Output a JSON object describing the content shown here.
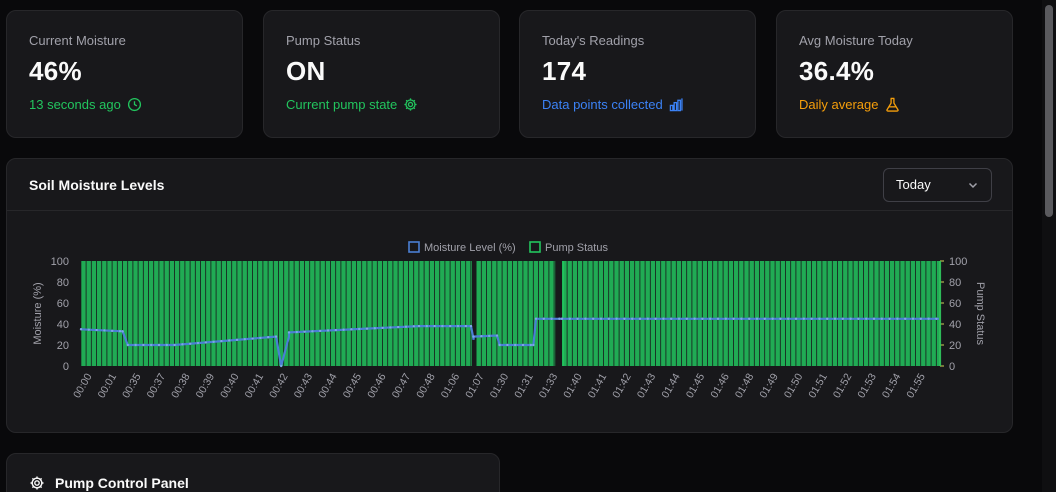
{
  "stats": [
    {
      "label": "Current Moisture",
      "value": "46%",
      "sub": "13 seconds ago",
      "color": "#22c55e",
      "icon": "clock-icon"
    },
    {
      "label": "Pump Status",
      "value": "ON",
      "sub": "Current pump state",
      "color": "#22c55e",
      "icon": "gear-icon"
    },
    {
      "label": "Today's Readings",
      "value": "174",
      "sub": "Data points collected",
      "color": "#3b82f6",
      "icon": "bar-chart-icon"
    },
    {
      "label": "Avg Moisture Today",
      "value": "36.4%",
      "sub": "Daily average",
      "color": "#f59e0b",
      "icon": "flask-icon"
    }
  ],
  "chart": {
    "title": "Soil Moisture Levels",
    "range_select": "Today"
  },
  "pump_panel": {
    "title": "Pump Control Panel"
  },
  "chart_data": {
    "type": "bar",
    "legend": [
      "Moisture Level (%)",
      "Pump Status"
    ],
    "legend_position": "top-center",
    "ylabel_left": "Moisture (%)",
    "ylabel_right": "Pump Status",
    "ylim": [
      0,
      100
    ],
    "yticks": [
      0,
      20,
      40,
      60,
      80,
      100
    ],
    "colors": {
      "moisture": "#4a7fd4",
      "pump": "#22c55e"
    },
    "x_tick_labels": [
      "00:00",
      "00:01",
      "00:35",
      "00:37",
      "00:38",
      "00:39",
      "00:40",
      "00:41",
      "00:42",
      "00:43",
      "00:44",
      "00:45",
      "00:46",
      "00:47",
      "00:48",
      "01:06",
      "01:07",
      "01:30",
      "01:31",
      "01:33",
      "01:40",
      "01:41",
      "01:42",
      "01:43",
      "01:44",
      "01:45",
      "01:46",
      "01:48",
      "01:49",
      "01:50",
      "01:51",
      "01:52",
      "01:53",
      "01:54",
      "01:55"
    ],
    "moisture_segments": [
      {
        "from": 0,
        "to": 16,
        "start": 35,
        "end": 33
      },
      {
        "from": 16,
        "to": 18,
        "start": 33,
        "end": 20
      },
      {
        "from": 18,
        "to": 36,
        "start": 20,
        "end": 20
      },
      {
        "from": 36,
        "to": 75,
        "start": 20,
        "end": 28
      },
      {
        "from": 75,
        "to": 77,
        "start": 28,
        "end": 0
      },
      {
        "from": 77,
        "to": 80,
        "start": 0,
        "end": 28
      },
      {
        "from": 80,
        "to": 130,
        "start": 32,
        "end": 38
      },
      {
        "from": 130,
        "to": 150,
        "start": 38,
        "end": 38
      },
      {
        "from": 150,
        "to": 151,
        "start": 38,
        "end": 25
      },
      {
        "from": 151,
        "to": 160,
        "start": 28,
        "end": 29
      },
      {
        "from": 160,
        "to": 161,
        "start": 29,
        "end": 20
      },
      {
        "from": 161,
        "to": 174,
        "start": 20,
        "end": 20
      },
      {
        "from": 174,
        "to": 175,
        "start": 20,
        "end": 45
      },
      {
        "from": 175,
        "to": 185,
        "start": 45,
        "end": 45
      },
      {
        "from": 185,
        "to": 330,
        "start": 45,
        "end": 45
      }
    ],
    "pump_on_ranges": [
      [
        0,
        152
      ],
      [
        152,
        185
      ],
      [
        185,
        330
      ]
    ],
    "pump_value_when_on": 100,
    "n_points": 330
  }
}
